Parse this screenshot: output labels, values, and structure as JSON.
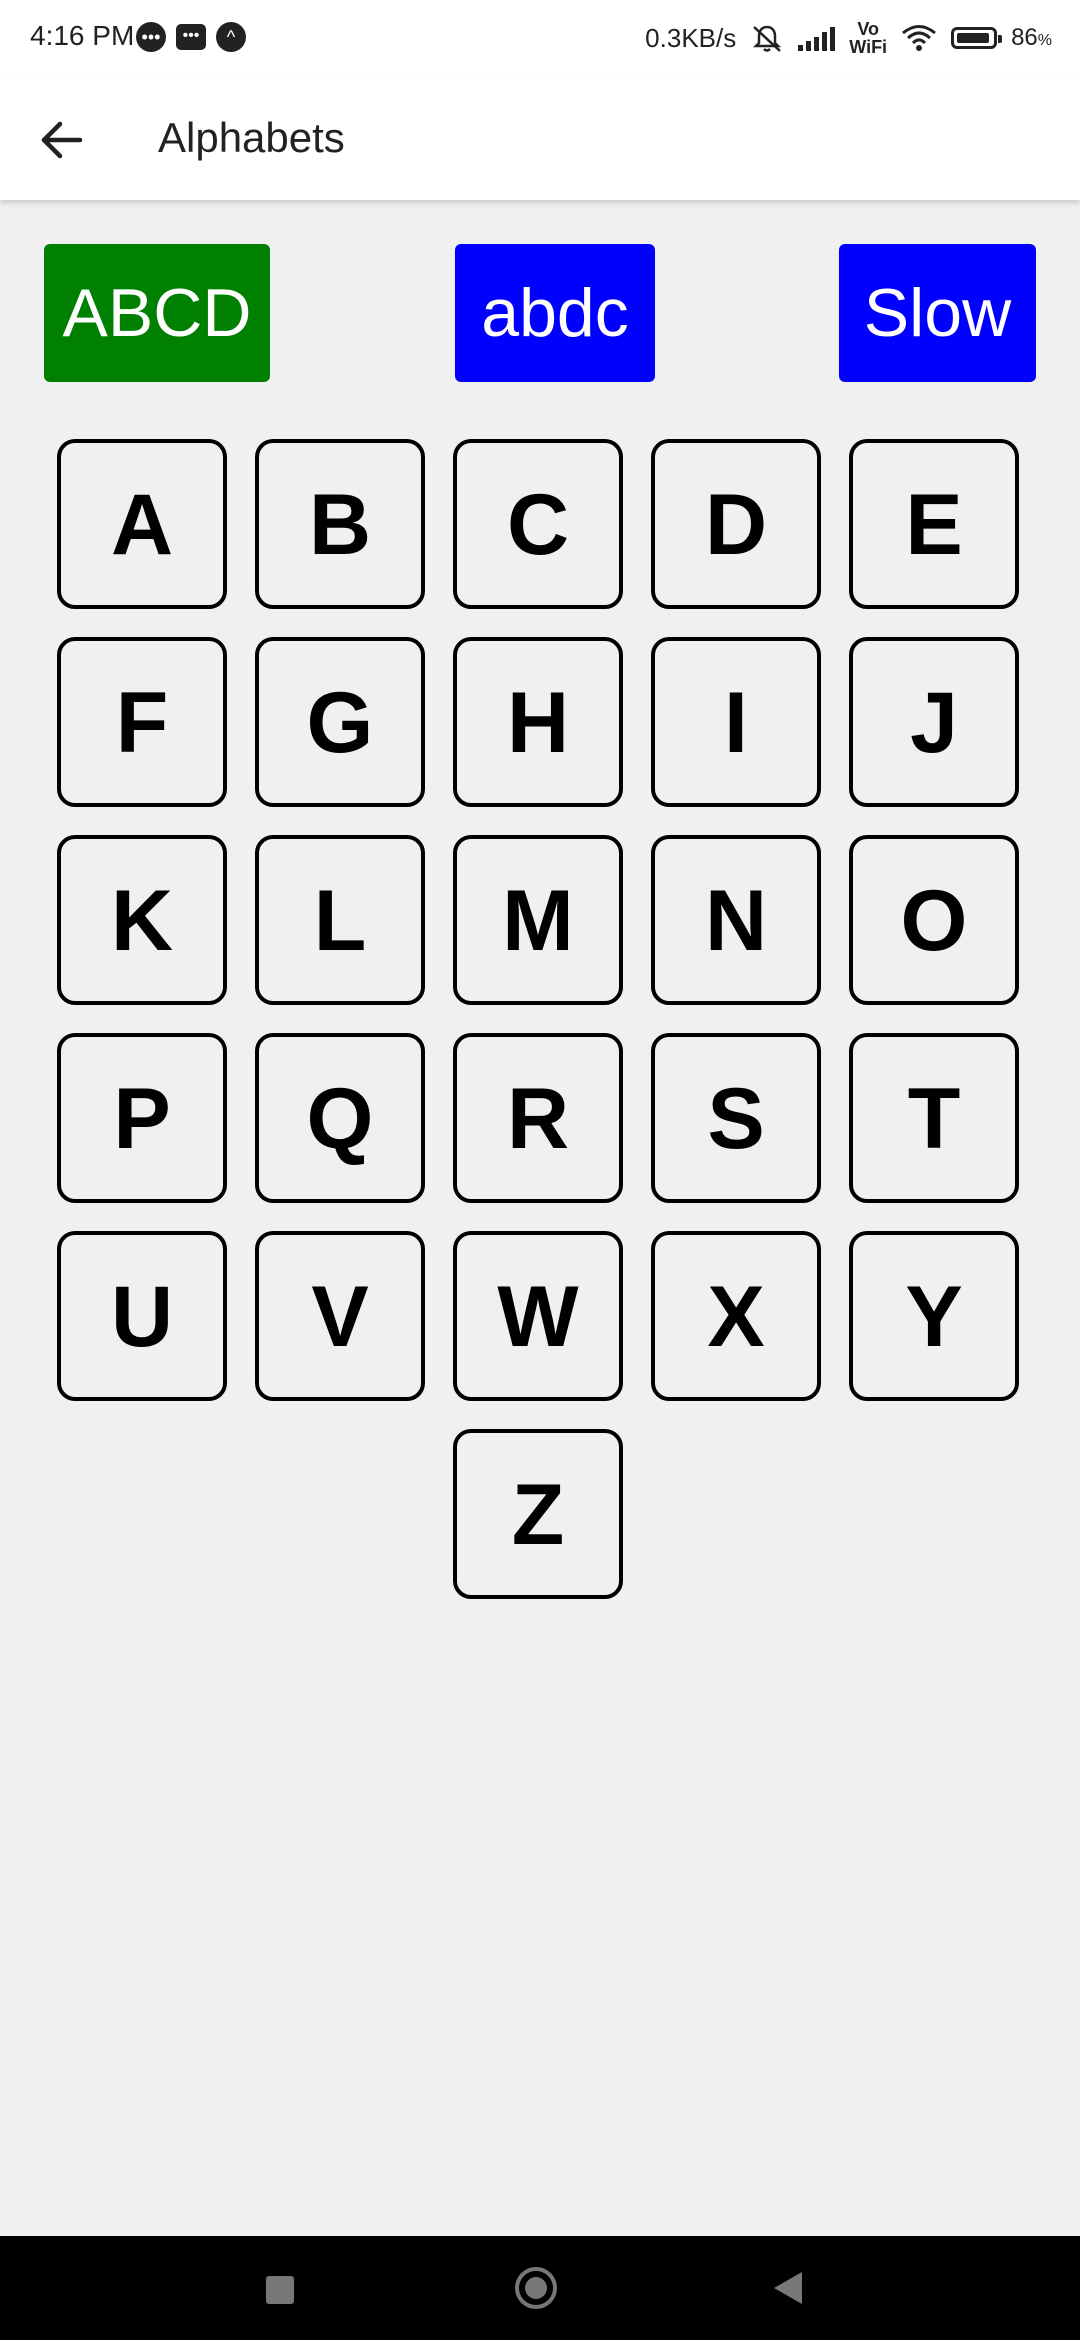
{
  "status_bar": {
    "time": "4:16 PM",
    "net_speed": "0.3KB/s",
    "vowifi_top": "Vo",
    "vowifi_bottom": "WiFi",
    "battery_value": "86",
    "battery_unit": "%",
    "icons": [
      "chat-bubble-icon",
      "message-icon",
      "app-notification-icon",
      "mute-icon",
      "signal-icon",
      "wifi-icon",
      "battery-icon"
    ]
  },
  "app_bar": {
    "title": "Alphabets",
    "back_icon": "arrow-left-icon"
  },
  "top_buttons": {
    "abcd_label": "ABCD",
    "abdc_label": "abdc",
    "slow_label": "Slow",
    "colors": {
      "abcd": "#008000",
      "abdc": "#0000ff",
      "slow": "#0000ff"
    }
  },
  "letters": [
    "A",
    "B",
    "C",
    "D",
    "E",
    "F",
    "G",
    "H",
    "I",
    "J",
    "K",
    "L",
    "M",
    "N",
    "O",
    "P",
    "Q",
    "R",
    "S",
    "T",
    "U",
    "V",
    "W",
    "X",
    "Y",
    "Z"
  ],
  "nav_bar": {
    "icons": [
      "recent-apps-icon",
      "home-icon",
      "back-triangle-icon"
    ]
  }
}
